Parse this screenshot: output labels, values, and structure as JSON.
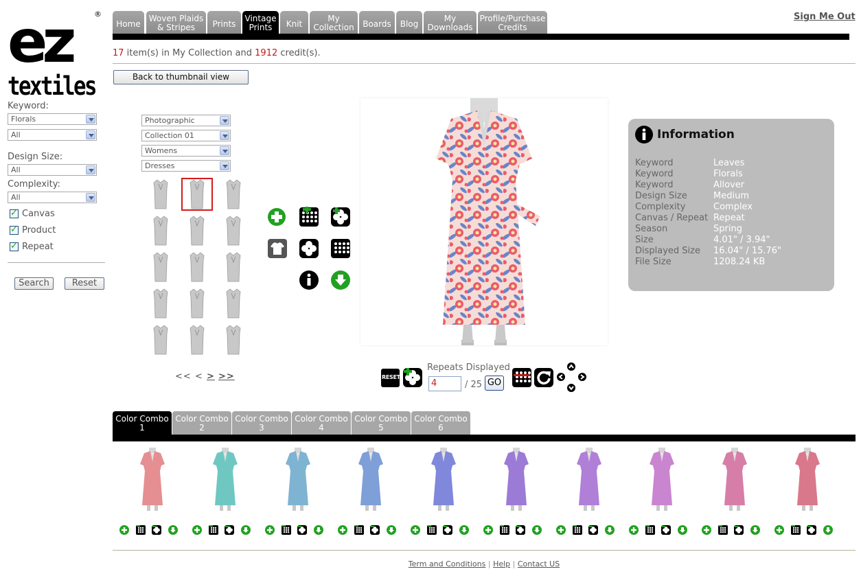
{
  "brand": {
    "line1": "ez",
    "line2": "textiles",
    "registered": "®"
  },
  "sidebar": {
    "keyword_label": "Keyword:",
    "keyword_value_1": "Florals",
    "keyword_value_2": "All",
    "design_size_label": "Design Size:",
    "design_size_value": "All",
    "complexity_label": "Complexity:",
    "complexity_value": "All",
    "checkboxes": [
      {
        "label": "Canvas",
        "checked": true
      },
      {
        "label": "Product",
        "checked": true
      },
      {
        "label": "Repeat",
        "checked": true
      }
    ],
    "search_label": "Search",
    "reset_label": "Reset"
  },
  "nav": {
    "tabs": [
      {
        "line1": "Home",
        "line2": ""
      },
      {
        "line1": "Woven Plaids",
        "line2": "& Stripes"
      },
      {
        "line1": "Prints",
        "line2": ""
      },
      {
        "line1": "Vintage",
        "line2": "Prints"
      },
      {
        "line1": "Knit",
        "line2": ""
      },
      {
        "line1": "My",
        "line2": "Collection"
      },
      {
        "line1": "Boards",
        "line2": ""
      },
      {
        "line1": "Blog",
        "line2": ""
      },
      {
        "line1": "My",
        "line2": "Downloads"
      },
      {
        "line1": "Profile/Purchase",
        "line2": "Credits"
      }
    ],
    "active_tab": "Vintage Prints",
    "sign_out": "Sign Me Out"
  },
  "collection": {
    "items": "17",
    "items_text": " item(s) in My Collection and ",
    "credits": "1912",
    "credits_text": " credit(s)."
  },
  "back_button": "Back to thumbnail view",
  "filters": {
    "style": "Photographic",
    "collection": "Collection 01",
    "gender": "Womens",
    "category": "Dresses"
  },
  "pager": {
    "first": "<<",
    "prev": "<",
    "next": ">",
    "last": ">>"
  },
  "info": {
    "title": "Information",
    "rows": [
      {
        "key": "Keyword",
        "value": "Leaves"
      },
      {
        "key": "Keyword",
        "value": "Florals"
      },
      {
        "key": "Keyword",
        "value": "Allover"
      },
      {
        "key": "Design Size",
        "value": "Medium"
      },
      {
        "key": "Complexity",
        "value": "Complex"
      },
      {
        "key": "Canvas / Repeat",
        "value": "Repeat"
      },
      {
        "key": "Season",
        "value": "Spring"
      },
      {
        "key": "Size",
        "value": "4.01\" / 3.94\""
      },
      {
        "key": "Displayed Size",
        "value": "16.04\" / 15.76\""
      },
      {
        "key": "File Size",
        "value": "1208.24 KB"
      }
    ]
  },
  "repeat_controls": {
    "reset_label": "RESET",
    "label": "Repeats Displayed",
    "value": "4",
    "total": "/ 25",
    "go_label": "GO"
  },
  "color_combos": {
    "tabs": [
      {
        "line1": "Color Combo",
        "line2": "1"
      },
      {
        "line1": "Color Combo",
        "line2": "2"
      },
      {
        "line1": "Color Combo",
        "line2": "3"
      },
      {
        "line1": "Color Combo",
        "line2": "4"
      },
      {
        "line1": "Color Combo",
        "line2": "5"
      },
      {
        "line1": "Color Combo",
        "line2": "6"
      }
    ],
    "active": "1",
    "swatch_colors": [
      "#e58f92",
      "#6fc7c2",
      "#7fb3d2",
      "#7e9fd8",
      "#7f88da",
      "#9c7bd6",
      "#b07fd8",
      "#c985d0",
      "#d67ea8",
      "#d9788a"
    ]
  },
  "footer": {
    "terms": "Term and Conditions",
    "sep": "|",
    "help": "Help",
    "contact": "Contact US"
  },
  "colors": {
    "accent_red": "#c0181d",
    "tab_gray": "#999999",
    "tab_active": "#000000",
    "panel_gray": "#bcbcbc",
    "icon_green": "#21a121"
  }
}
